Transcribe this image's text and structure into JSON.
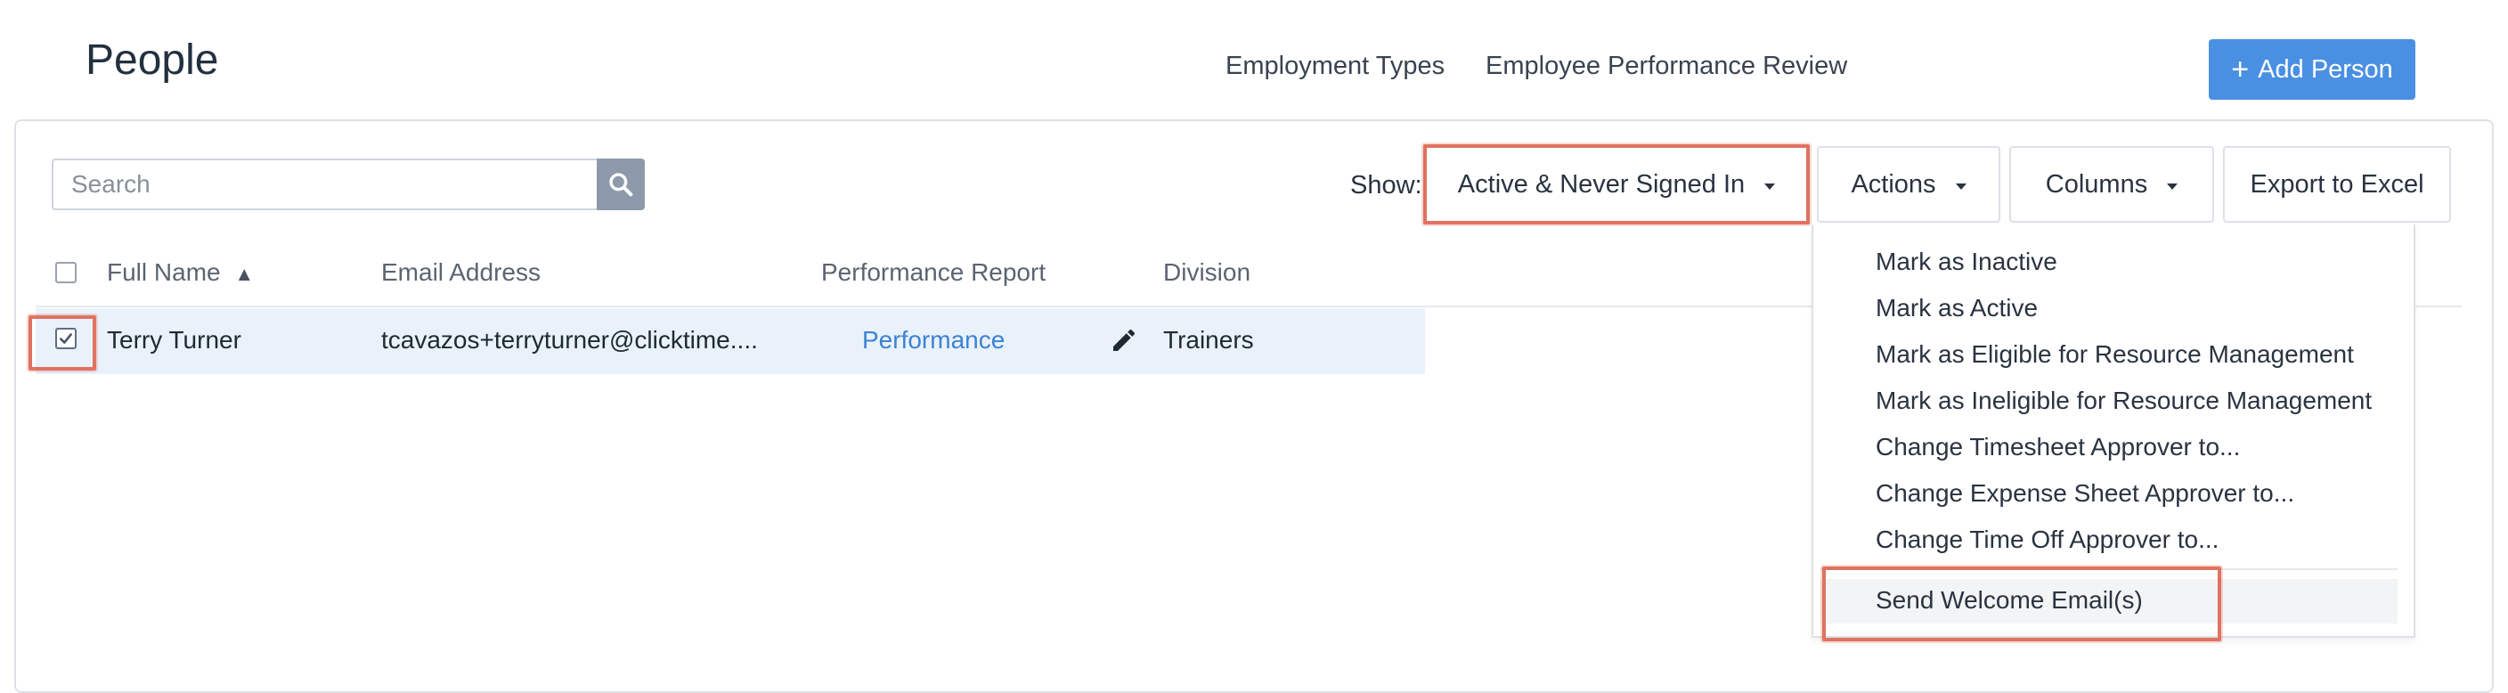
{
  "header": {
    "title": "People",
    "links": [
      "Employment Types",
      "Employee Performance Review"
    ],
    "add_button": {
      "icon": "+",
      "label": "Add Person"
    }
  },
  "toolbar": {
    "search_placeholder": "Search",
    "show_label": "Show:",
    "show_value": "Active & Never Signed In",
    "actions_label": "Actions",
    "columns_label": "Columns",
    "export_label": "Export to Excel"
  },
  "table": {
    "columns": [
      "Full Name",
      "Email Address",
      "Performance Report",
      "Division"
    ],
    "sort_indicator": "▲",
    "rows": [
      {
        "name": "Terry Turner",
        "email": "tcavazos+terryturner@clicktime....",
        "performance": "Performance",
        "division": "Trainers",
        "checked": true
      }
    ]
  },
  "actions_menu": {
    "items": [
      "Mark as Inactive",
      "Mark as Active",
      "Mark as Eligible for Resource Management",
      "Mark as Ineligible for Resource Management",
      "Change Timesheet Approver to...",
      "Change Expense Sheet Approver to...",
      "Change Time Off Approver to..."
    ],
    "highlighted_item": "Send Welcome Email(s)"
  },
  "colors": {
    "primary": "#4a90e2",
    "link": "#3b82d6",
    "highlight_border": "#e07260",
    "row_selected": "#e9f2fb"
  },
  "icons": {
    "search": "search-icon",
    "sort": "sort-ascending-icon",
    "edit": "pencil-icon",
    "caret": "caret-down-icon",
    "check": "check-icon"
  }
}
